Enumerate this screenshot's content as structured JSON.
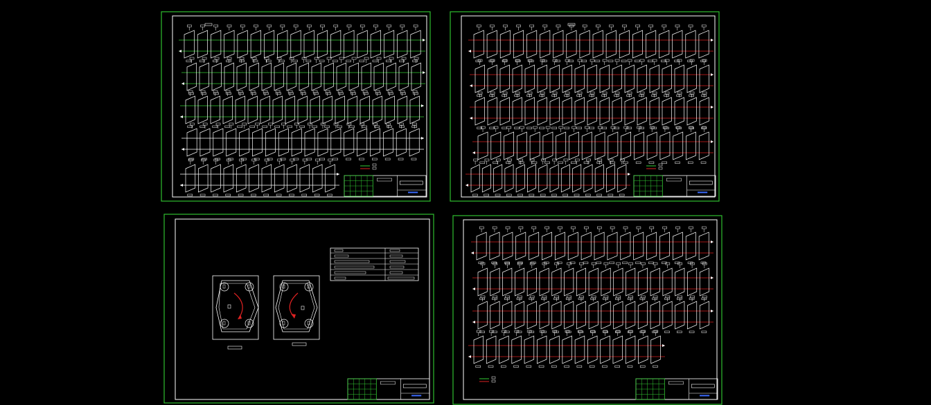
{
  "colors": {
    "background": "#000000",
    "sheet_border": "#2fbf2f",
    "inner_frame": "#ffffff",
    "wire_white": "#ffffff",
    "wire_green": "#33cc33",
    "wire_red": "#dd2222",
    "title_block_green": "#33cc33",
    "accent_blue": "#3b6cff"
  },
  "sheets": [
    {
      "id": "sheet-top-left",
      "wire_color": "green",
      "content": "cable-schematic",
      "rows": 5
    },
    {
      "id": "sheet-top-right",
      "wire_color": "red",
      "content": "cable-schematic",
      "rows": 5
    },
    {
      "id": "sheet-bottom-left",
      "wire_color": "none",
      "content": "flange-plan",
      "rows": 0
    },
    {
      "id": "sheet-bottom-right",
      "wire_color": "red",
      "content": "cable-schematic",
      "rows": 4
    }
  ],
  "icons": [
    "legend-icon",
    "arrow-icon",
    "title-block-icon"
  ]
}
